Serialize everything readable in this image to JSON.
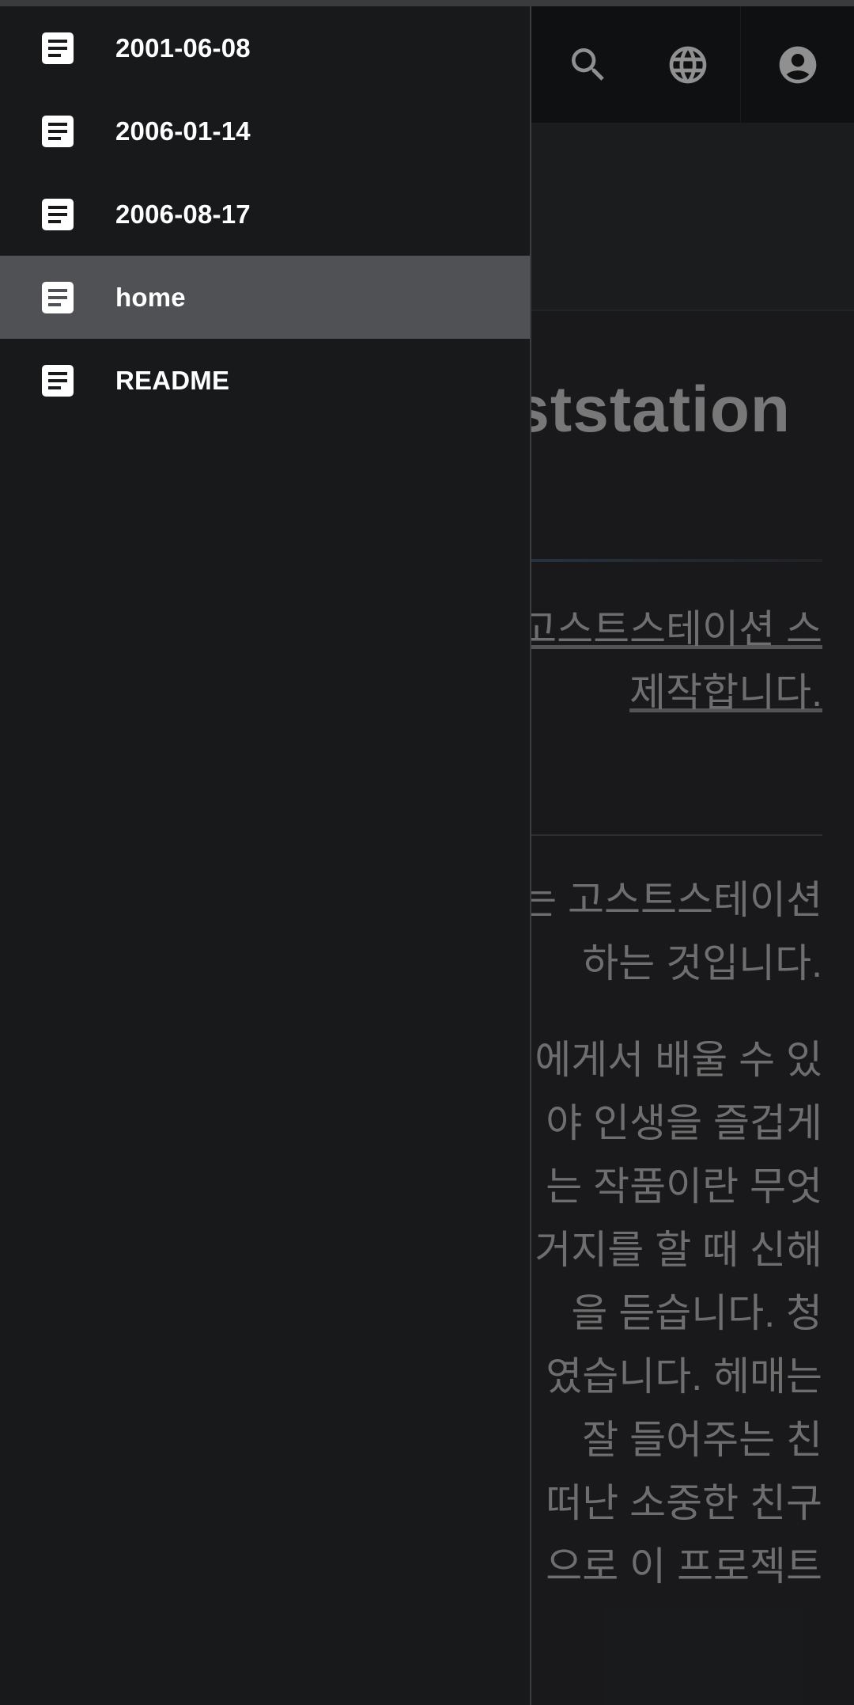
{
  "header": {
    "icons": [
      "search-icon",
      "globe-icon",
      "account-icon"
    ]
  },
  "main": {
    "title": "ststation",
    "intro": [
      "고스트스테이션 스",
      "제작합니다."
    ],
    "body1": [
      "는 고스트스테이션",
      "하는 것입니다."
    ],
    "body2": [
      "에게서 배울 수 있",
      "야 인생을 즐겁게",
      "는 작품이란 무엇",
      "거지를 할 때 신해",
      "을 듣습니다. 청",
      "였습니다. 헤매는",
      "잘 들어주는 친",
      "떠난 소중한 친구",
      "으로 이 프로젝트"
    ]
  },
  "drawer": {
    "items": [
      {
        "label": "2001-06-08",
        "icon": "document-icon",
        "selected": false
      },
      {
        "label": "2006-01-14",
        "icon": "document-icon",
        "selected": false
      },
      {
        "label": "2006-08-17",
        "icon": "document-icon",
        "selected": false
      },
      {
        "label": "home",
        "icon": "document-icon",
        "selected": true
      },
      {
        "label": "README",
        "icon": "document-icon",
        "selected": false
      }
    ]
  },
  "colors": {
    "drawer_bg": "#18191b",
    "selected_bg": "#505154",
    "accent_rule": "#3a6ea6"
  }
}
